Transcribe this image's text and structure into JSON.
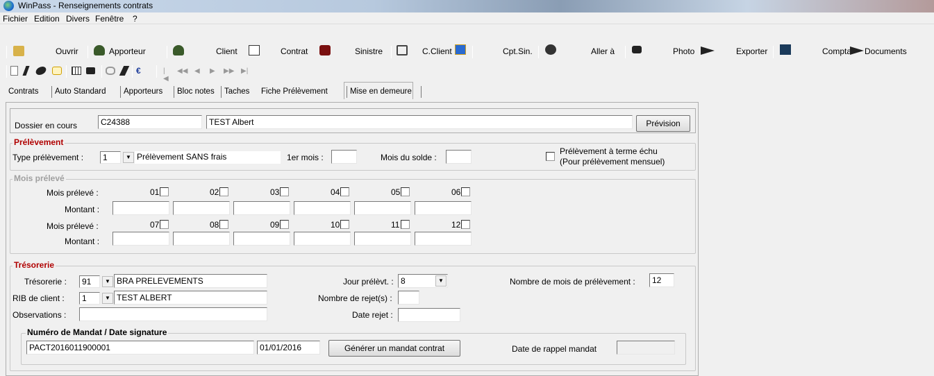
{
  "window": {
    "title": "WinPass - Renseignements contrats"
  },
  "menu": [
    "Fichier",
    "Edition",
    "Divers",
    "Fenêtre",
    "?"
  ],
  "toolbar": {
    "ouvrir": "Ouvrir",
    "apporteur": "Apporteur",
    "client": "Client",
    "contrat": "Contrat",
    "sinistre": "Sinistre",
    "cclient": "C.Client",
    "cptsin": "Cpt.Sin.",
    "allera": "Aller à",
    "photo": "Photo",
    "exporter": "Exporter",
    "compta": "Compta",
    "documents": "Documents"
  },
  "tabs": [
    "Contrats",
    "Auto Standard",
    "Apporteurs",
    "Bloc notes",
    "Taches",
    "Fiche Prélèvement",
    "Mise en demeure"
  ],
  "dossier": {
    "label": "Dossier en cours",
    "code": "C24388",
    "name": "TEST Albert",
    "prevision_button": "Prévision"
  },
  "prelevement": {
    "title": "Prélèvement",
    "type_label": "Type prélèvement :",
    "type_code": "1",
    "type_value": "Prélèvement SANS frais",
    "premier_mois_label": "1er mois :",
    "premier_mois_value": "",
    "mois_solde_label": "Mois du solde :",
    "mois_solde_value": "",
    "terme_echu_label1": "Prélèvement à terme échu",
    "terme_echu_label2": "(Pour prélèvement mensuel)",
    "terme_echu_checked": false
  },
  "mois_preleve": {
    "title": "Mois prélevé",
    "row_label": "Mois prélevé :",
    "montant_label": "Montant :",
    "months_row1": [
      "01",
      "02",
      "03",
      "04",
      "05",
      "06"
    ],
    "months_row2": [
      "07",
      "08",
      "09",
      "10",
      "11",
      "12"
    ]
  },
  "tresorerie": {
    "title": "Trésorerie",
    "tresorerie_label": "Trésorerie :",
    "tresorerie_code": "91",
    "tresorerie_value": "BRA  PRELEVEMENTS",
    "rib_label": "RIB de client :",
    "rib_code": "1",
    "rib_value": "TEST ALBERT",
    "observations_label": "Observations :",
    "observations_value": "",
    "jour_label": "Jour prélèvt. :",
    "jour_value": "8",
    "nb_rejets_label": "Nombre de rejet(s) :",
    "nb_rejets_value": "",
    "date_rejet_label": "Date rejet :",
    "date_rejet_value": "",
    "nb_mois_label": "Nombre de mois de prélèvement :",
    "nb_mois_value": "12"
  },
  "mandat": {
    "title": "Numéro de Mandat / Date signature",
    "numero": "PACT2016011900001",
    "date": "01/01/2016",
    "generer_button": "Générer un mandat contrat",
    "rappel_label": "Date de rappel mandat",
    "rappel_value": ""
  }
}
